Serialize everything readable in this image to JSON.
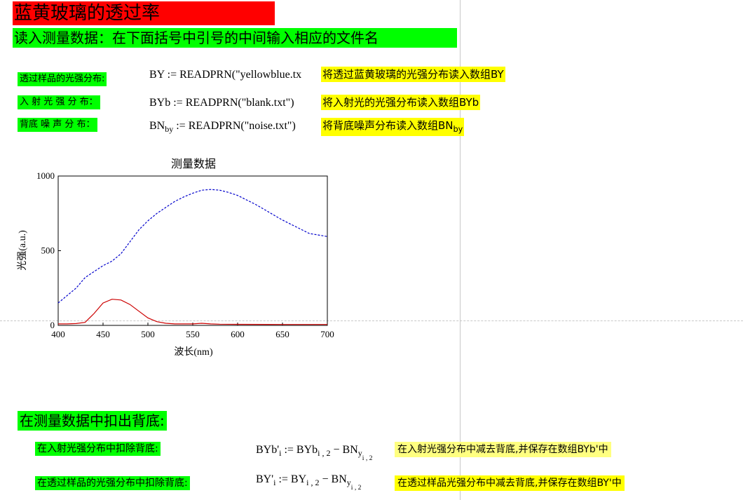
{
  "header": {
    "title": "蓝黄玻璃的透过率",
    "subtitle": "读入测量数据：在下面括号中引号的中间输入相应的文件名"
  },
  "rows": [
    {
      "label": "透过样品的光强分布:",
      "formula": "BY := READPRN(\"yellowblue.tx",
      "comment": "将透过蓝黄玻璃的光强分布读入数组BY"
    },
    {
      "label": "入 射 光 强 分 布：",
      "formula": "BYb := READPRN(\"blank.txt\")",
      "comment": "将入射光的光强分布读入数组BYb"
    },
    {
      "label": "背底 噪 声 分 布：",
      "formula_main": "BN",
      "formula_sub": "by",
      "formula_rest": " := READPRN(\"noise.txt\")",
      "comment_main": "将背底噪声分布读入数组BN",
      "comment_sub": "by"
    }
  ],
  "colors": {
    "title_bg": "#ff0000",
    "label_bg": "#00ff00",
    "comment_bg": "#ffff00",
    "comment_pale_bg": "#ffff80",
    "series_blue": "#0000cc",
    "series_red": "#cc0000"
  },
  "chart_data": {
    "type": "line",
    "title": "测量数据",
    "xlabel": "波长(nm)",
    "ylabel": "光强(a.u.)",
    "xlim": [
      400,
      700
    ],
    "ylim": [
      0,
      1000
    ],
    "xticks": [
      400,
      450,
      500,
      550,
      600,
      650,
      700
    ],
    "yticks": [
      0,
      500,
      1000
    ],
    "series": [
      {
        "style": "dashed",
        "color": "#0000cc",
        "x": [
          400,
          410,
          420,
          430,
          440,
          450,
          460,
          470,
          480,
          490,
          500,
          510,
          520,
          530,
          540,
          550,
          560,
          570,
          580,
          590,
          600,
          610,
          620,
          630,
          640,
          650,
          660,
          670,
          680,
          690,
          700
        ],
        "y": [
          150,
          200,
          250,
          320,
          360,
          400,
          430,
          480,
          560,
          640,
          700,
          750,
          790,
          830,
          860,
          885,
          905,
          910,
          905,
          890,
          870,
          840,
          810,
          775,
          740,
          705,
          675,
          645,
          615,
          605,
          595
        ]
      },
      {
        "style": "solid",
        "color": "#cc0000",
        "x": [
          400,
          410,
          420,
          430,
          440,
          450,
          460,
          470,
          480,
          490,
          500,
          510,
          520,
          530,
          540,
          550,
          560,
          570,
          580,
          600,
          650,
          700
        ],
        "y": [
          10,
          10,
          12,
          20,
          80,
          150,
          175,
          170,
          140,
          95,
          50,
          25,
          14,
          10,
          10,
          10,
          14,
          10,
          8,
          7,
          6,
          6
        ]
      }
    ]
  },
  "section": {
    "heading": "在测量数据中扣出背底:",
    "rows": [
      {
        "label": "在入射光强分布中扣除背底:",
        "lhs": "BYb'",
        "lhs_sub": "i",
        "op": " := BYb",
        "rhs_sub": "i , 2",
        "minus": " − BN",
        "bn_sub": "y",
        "bn_subsub": "i , 2",
        "comment": "在入射光强分布中减去背底,并保存在数组BYb'中"
      },
      {
        "label": "在透过样品的光强分布中扣除背底:",
        "lhs": "BY'",
        "lhs_sub": "i",
        "op": " := BY",
        "rhs_sub": "i , 2",
        "minus": " − BN",
        "bn_sub": "y",
        "bn_subsub": "i , 2",
        "comment": "在透过样品光强分布中减去背底,并保存在数组BY'中"
      }
    ]
  }
}
